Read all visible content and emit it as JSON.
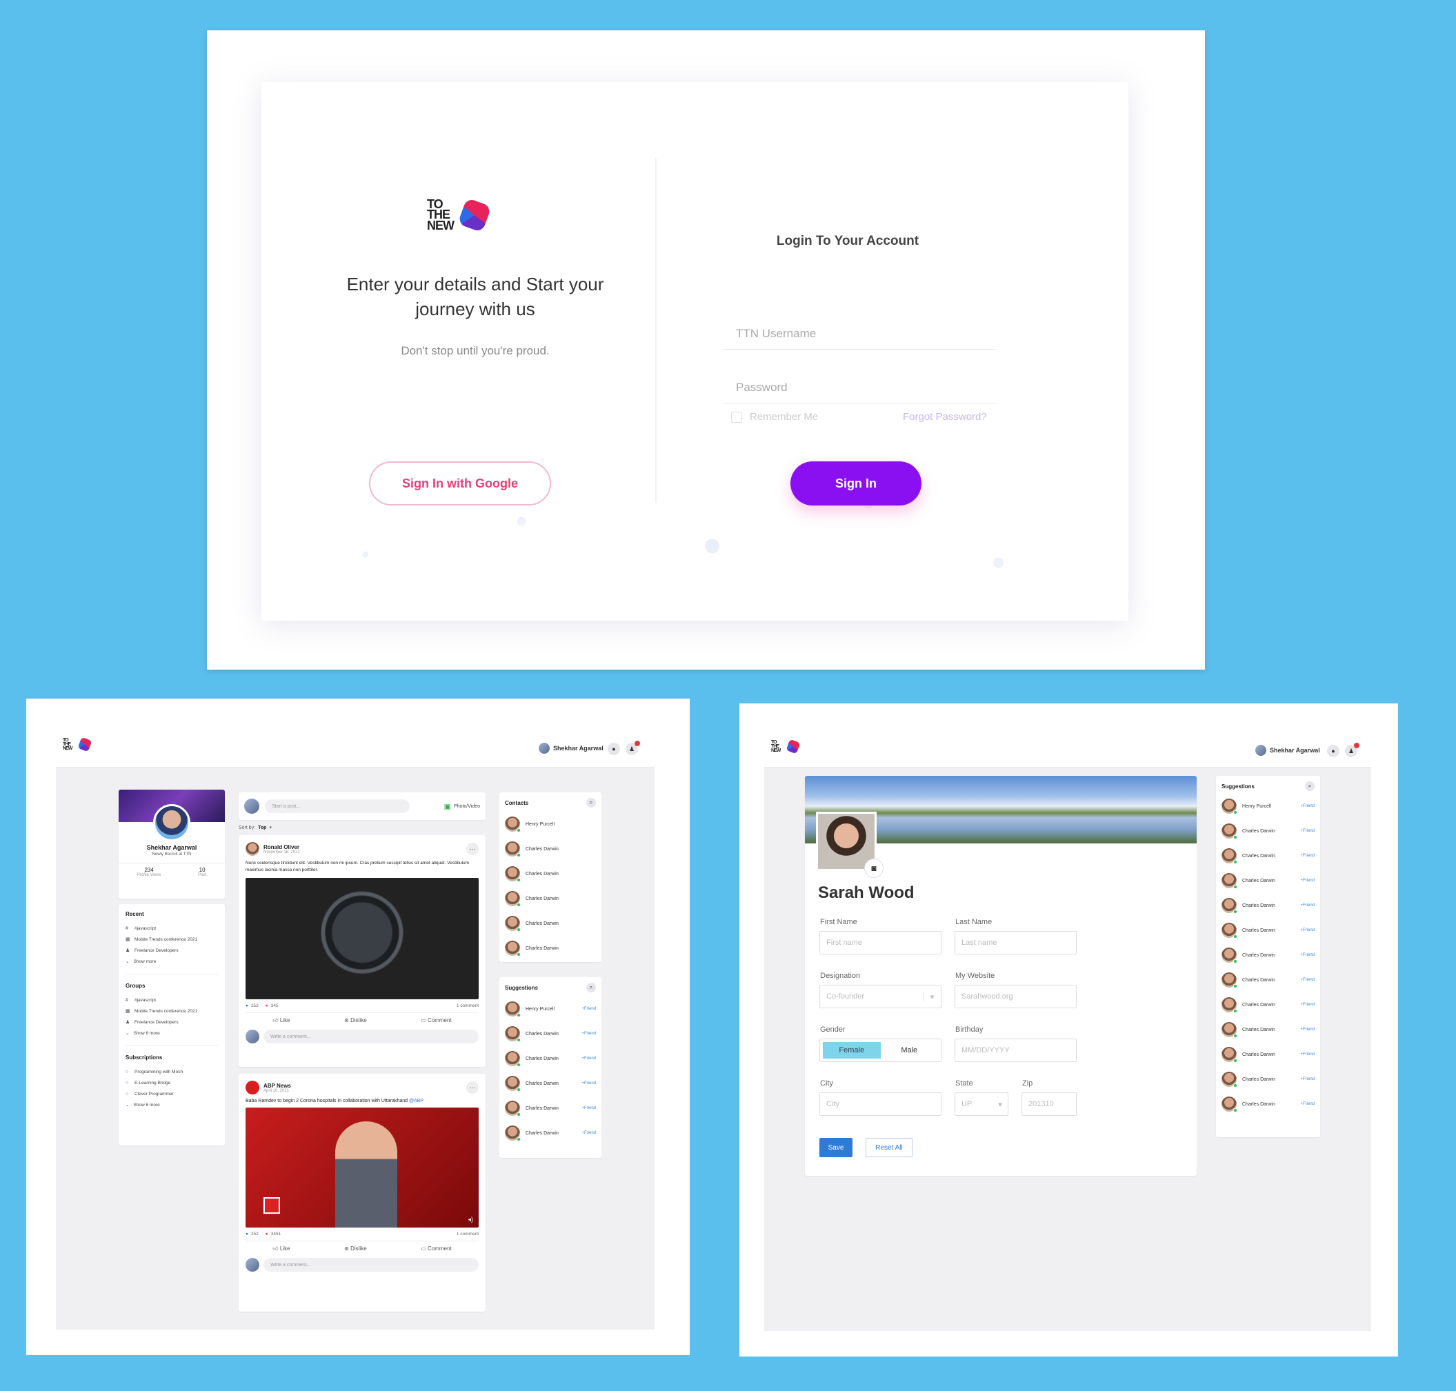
{
  "login": {
    "logo_text": "TO THE NEW",
    "tagline": "Enter your details and Start your journey with us",
    "subtext": "Don't stop until you're proud.",
    "google_button": "Sign In with Google",
    "heading": "Login To Your Account",
    "username_placeholder": "TTN Username",
    "password_placeholder": "Password",
    "remember_label": "Remember Me",
    "forgot_link": "Forgot Password?",
    "signin_button": "Sign In",
    "colors": {
      "primary": "#8a10f2",
      "google": "#e2407a"
    }
  },
  "feed": {
    "user_name": "Shekhar Agarwal",
    "profile": {
      "name": "Shekhar Agarwal",
      "subtitle": "Newly Recruit at TTN",
      "views": "234",
      "views_label": "Profile Views",
      "posts": "10",
      "posts_label": "Post"
    },
    "recent": {
      "title": "Recent",
      "items": [
        "#javascript",
        "Mobile Trends conference 2021",
        "Freelance Developers"
      ],
      "more": "Show more"
    },
    "groups": {
      "title": "Groups",
      "items": [
        "#javascript",
        "Mobile Trends conference 2021",
        "Freelance Developers"
      ],
      "more": "Show 6 more"
    },
    "subscriptions": {
      "title": "Subscriptions",
      "items": [
        "Programming with Mosh",
        "E-Learning Bridge",
        "Clever Programmer"
      ],
      "more": "Show 6 more"
    },
    "composer": {
      "placeholder": "Start a post...",
      "photo_label": "Photo/Video"
    },
    "sort": {
      "label": "Sort by:",
      "value": "Top"
    },
    "posts": [
      {
        "author": "Ronald Oliver",
        "date": "November 16, 2021",
        "text": "Nunc scelerisque tincidunt elit. Vestibulum non mi ipsum. Cras pretium suscipit tellus sit amet aliquet. Vestibulum maximus lacinia massa non porttitor.",
        "likes": "252",
        "hearts": "345",
        "comments": "1 comment"
      },
      {
        "author": "ABP News",
        "date": "April 16, 2021",
        "text": "Baba Ramdev to begin 2 Corona hospitals in collaboration with Uttarakhand",
        "mention": "@ABP",
        "likes": "252",
        "hearts": "3451",
        "comments": "1 comment"
      }
    ],
    "actions": {
      "like": "Like",
      "dislike": "Dislike",
      "comment": "Comment",
      "write_comment": "Write a comment..."
    },
    "contacts": {
      "title": "Contacts",
      "items": [
        "Henry Purcell",
        "Charles Darwin",
        "Charles Darwin",
        "Charles Darwin",
        "Charles Darwin",
        "Charles Darwin"
      ]
    },
    "suggestions": {
      "title": "Suggestions",
      "add_label": "+Friend",
      "items": [
        "Henry Purcell",
        "Charles Darwin",
        "Charles Darwin",
        "Charles Darwin",
        "Charles Darwin",
        "Charles Darwin"
      ]
    }
  },
  "profile": {
    "user_name": "Shekhar Agarwal",
    "name": "Sarah Wood",
    "first_name_label": "First Name",
    "first_name_placeholder": "First name",
    "last_name_label": "Last Name",
    "last_name_placeholder": "Last name",
    "designation_label": "Designation",
    "designation_value": "Co-founder",
    "website_label": "My Website",
    "website_value": "Sarahwood.org",
    "gender_label": "Gender",
    "gender_female": "Female",
    "gender_male": "Male",
    "birthday_label": "Birthday",
    "birthday_placeholder": "MM/DD/YYYY",
    "city_label": "City",
    "city_placeholder": "City",
    "state_label": "State",
    "state_value": "UP",
    "zip_label": "Zip",
    "zip_value": "201310",
    "save": "Save",
    "reset": "Reset All",
    "suggestions": {
      "title": "Suggestions",
      "add_label": "+Friend",
      "items": [
        "Henry Purcell",
        "Charles Darwin",
        "Charles Darwin",
        "Charles Darwin",
        "Charles Darwin",
        "Charles Darwin",
        "Charles Darwin",
        "Charles Darwin",
        "Charles Darwin",
        "Charles Darwin",
        "Charles Darwin",
        "Charles Darwin",
        "Charles Darwin"
      ]
    }
  }
}
